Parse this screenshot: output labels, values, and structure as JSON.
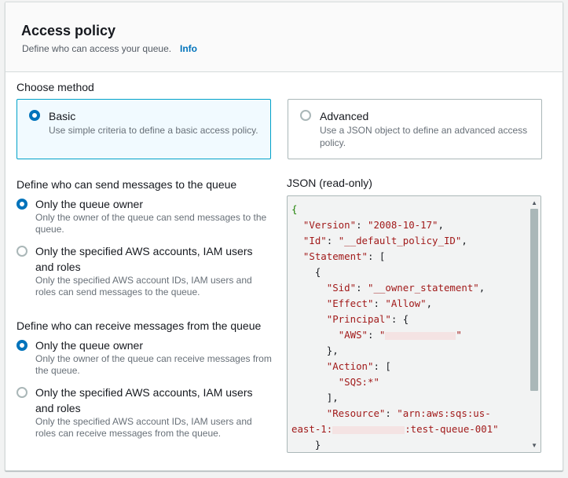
{
  "panel": {
    "title": "Access policy",
    "description": "Define who can access your queue.",
    "info_link": "Info"
  },
  "method": {
    "label": "Choose method",
    "selected": "Basic",
    "options": [
      {
        "title": "Basic",
        "description": "Use simple criteria to define a basic access policy."
      },
      {
        "title": "Advanced",
        "description": "Use a JSON object to define an advanced access policy."
      }
    ]
  },
  "send_section": {
    "label": "Define who can send messages to the queue",
    "options": [
      {
        "title": "Only the queue owner",
        "description": "Only the owner of the queue can send messages to the queue.",
        "checked": true
      },
      {
        "title": "Only the specified AWS accounts, IAM users and roles",
        "description": "Only the specified AWS account IDs, IAM users and roles can send messages to the queue.",
        "checked": false
      }
    ]
  },
  "receive_section": {
    "label": "Define who can receive messages from the queue",
    "options": [
      {
        "title": "Only the queue owner",
        "description": "Only the owner of the queue can receive messages from the queue.",
        "checked": true
      },
      {
        "title": "Only the specified AWS accounts, IAM users and roles",
        "description": "Only the specified AWS account IDs, IAM users and roles can receive messages from the queue.",
        "checked": false
      }
    ]
  },
  "json_panel": {
    "label": "JSON (read-only)",
    "lines": {
      "open": "{",
      "version_key": "\"Version\"",
      "version_val": "\"2008-10-17\"",
      "id_key": "\"Id\"",
      "id_val": "\"__default_policy_ID\"",
      "statement_key": "\"Statement\"",
      "statement_open": "[",
      "obj_open": "{",
      "sid_key": "\"Sid\"",
      "sid_val": "\"__owner_statement\"",
      "effect_key": "\"Effect\"",
      "effect_val": "\"Allow\"",
      "principal_key": "\"Principal\"",
      "principal_open": "{",
      "aws_key": "\"AWS\"",
      "aws_val_start": "\"",
      "aws_val_end": "\"",
      "principal_close": "},",
      "action_key": "\"Action\"",
      "action_open": "[",
      "action_val": "\"SQS:*\"",
      "action_close": "],",
      "resource_key": "\"Resource\"",
      "resource_val_start": "\"arn:aws:sqs:us-",
      "resource_val_mid": "east-1:",
      "resource_val_end": ":test-queue-001\"",
      "tail": "}"
    }
  },
  "colors": {
    "accent": "#0073bb",
    "selected_tile_bg": "#f1faff",
    "selected_tile_border": "#00a1c9",
    "json_key": "#a11a1a",
    "json_brace": "#1d8102"
  }
}
